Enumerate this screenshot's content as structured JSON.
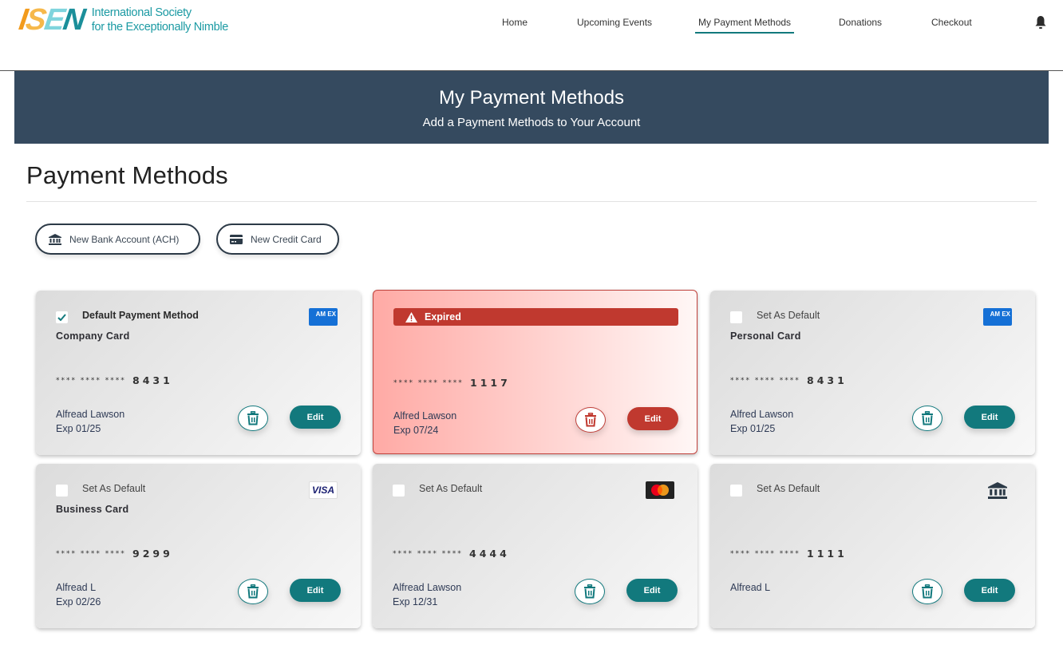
{
  "header": {
    "logo_mark": [
      "I",
      "S",
      "E",
      "N"
    ],
    "logo_line1": "International Society",
    "logo_line2": "for the Exceptionally Nimble",
    "nav": [
      {
        "label": "Home",
        "active": false
      },
      {
        "label": "Upcoming Events",
        "active": false
      },
      {
        "label": "My Payment Methods",
        "active": true
      },
      {
        "label": "Donations",
        "active": false
      },
      {
        "label": "Checkout",
        "active": false
      }
    ],
    "bell_icon": "bell-icon"
  },
  "banner": {
    "title": "My Payment Methods",
    "subtitle": "Add a Payment Methods to Your Account"
  },
  "section": {
    "title": "Payment Methods",
    "buttons": {
      "new_bank": {
        "label": "New Bank Account (ACH)",
        "icon": "bank-icon"
      },
      "new_credit": {
        "label": "New Credit Card",
        "icon": "credit-card-icon"
      }
    }
  },
  "cards": [
    {
      "default_label": "Default Payment Method",
      "is_default": true,
      "name": "Company Card",
      "mask": "**** **** ****",
      "last4": "8431",
      "holder": "Alfread Lawson",
      "expiry": "Exp 01/25",
      "brand": "amex",
      "brand_text": "AM EX",
      "expired": false,
      "edit_label": "Edit"
    },
    {
      "expired_label": "Expired",
      "expired": true,
      "name": "",
      "mask": "**** **** ****",
      "last4": "1117",
      "holder": "Alfred Lawson",
      "expiry": "Exp 07/24",
      "brand": "",
      "edit_label": "Edit"
    },
    {
      "default_label": "Set As Default",
      "is_default": false,
      "name": "Personal Card",
      "mask": "**** **** ****",
      "last4": "8431",
      "holder": "Alfred Lawson",
      "expiry": "Exp 01/25",
      "brand": "amex",
      "brand_text": "AM EX",
      "expired": false,
      "edit_label": "Edit"
    },
    {
      "default_label": "Set As Default",
      "is_default": false,
      "name": "Business Card",
      "mask": "**** **** ****",
      "last4": "9299",
      "holder": "Alfread L",
      "expiry": "Exp 02/26",
      "brand": "visa",
      "brand_text": "VISA",
      "expired": false,
      "edit_label": "Edit"
    },
    {
      "default_label": "Set As Default",
      "is_default": false,
      "name": "",
      "mask": "**** **** ****",
      "last4": "4444",
      "holder": "Alfread Lawson",
      "expiry": "Exp 12/31",
      "brand": "mastercard",
      "expired": false,
      "edit_label": "Edit"
    },
    {
      "default_label": "Set As Default",
      "is_default": false,
      "name": "",
      "mask": "**** **** ****",
      "last4": "1111",
      "holder": "Alfread L",
      "expiry": "",
      "brand": "bank",
      "expired": false,
      "edit_label": "Edit"
    }
  ],
  "colors": {
    "accent": "#12797d",
    "banner": "#354a5f",
    "expired": "#c0392f",
    "amex": "#1570d6"
  }
}
